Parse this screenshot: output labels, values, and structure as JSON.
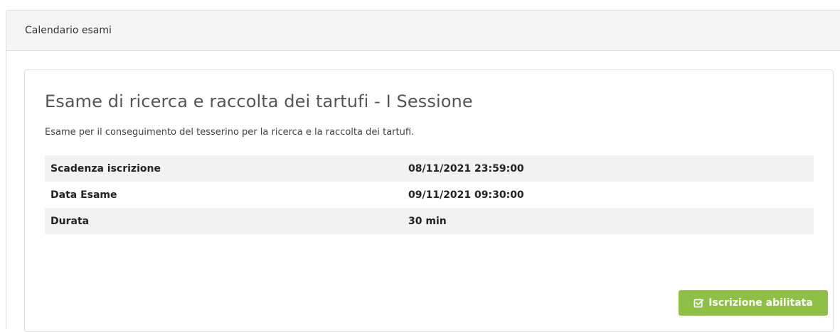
{
  "panel": {
    "heading": "Calendario esami"
  },
  "exam": {
    "title": "Esame di ricerca e raccolta dei tartufi - I Sessione",
    "description": "Esame per il conseguimento del tesserino per la ricerca e la raccolta dei tartufi.",
    "details": [
      {
        "label": "Scadenza iscrizione",
        "value": "08/11/2021 23:59:00"
      },
      {
        "label": "Data Esame",
        "value": "09/11/2021 09:30:00"
      },
      {
        "label": "Durata",
        "value": "30 min"
      }
    ],
    "button": {
      "label": "Iscrizione abilitata",
      "icon": "check-square-icon",
      "color": "#8dc045"
    }
  }
}
